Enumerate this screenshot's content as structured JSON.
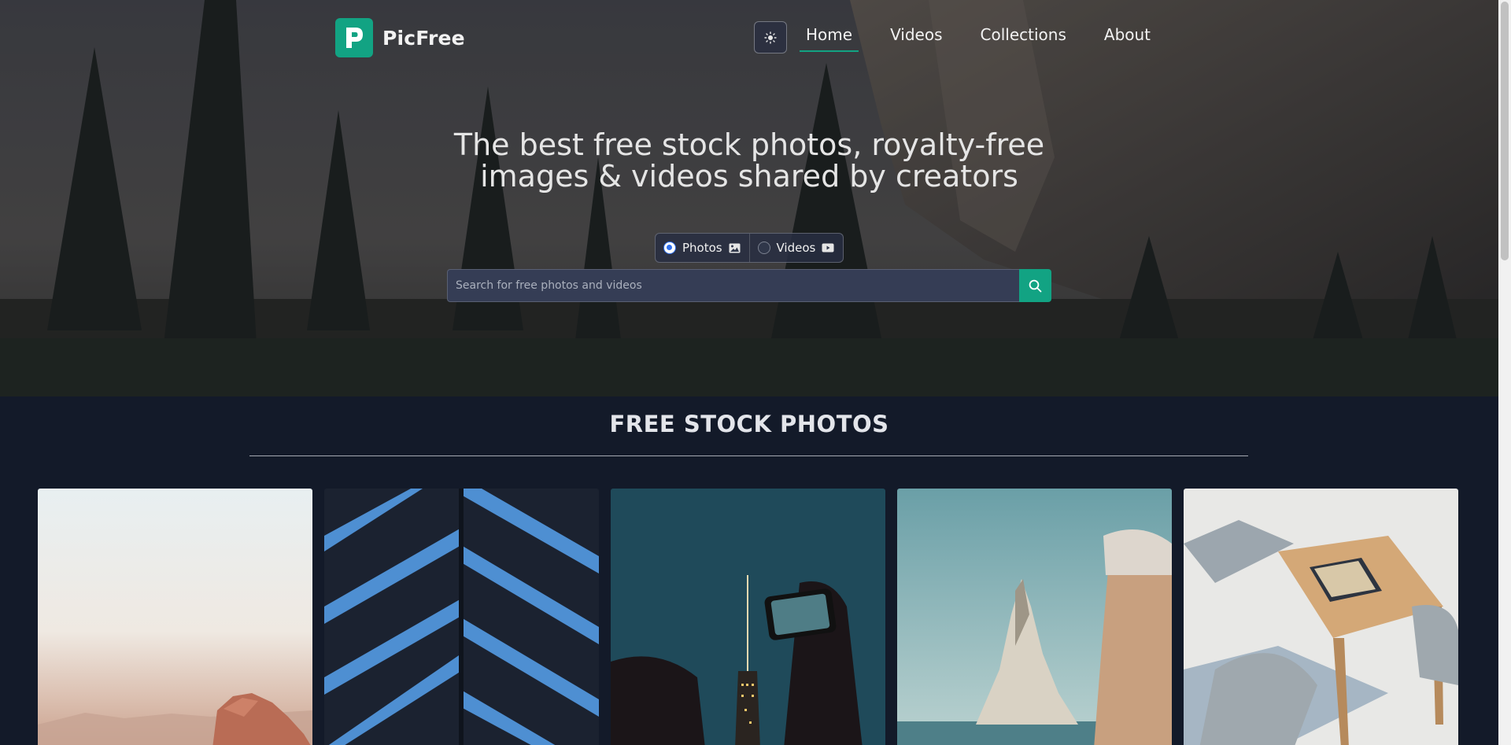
{
  "brand": {
    "name": "PicFree",
    "logo_icon": "picfree-p-logo-icon"
  },
  "theme_toggle": {
    "icon": "sun-icon"
  },
  "nav": {
    "items": [
      {
        "label": "Home",
        "active": true
      },
      {
        "label": "Videos",
        "active": false
      },
      {
        "label": "Collections",
        "active": false
      },
      {
        "label": "About",
        "active": false
      }
    ]
  },
  "hero": {
    "title_line1": "The best free stock photos, royalty-free",
    "title_line2": "images & videos shared by creators",
    "media_types": [
      {
        "label": "Photos",
        "icon": "image-icon",
        "selected": true
      },
      {
        "label": "Videos",
        "icon": "video-icon",
        "selected": false
      }
    ],
    "search": {
      "placeholder": "Search for free photos and videos",
      "value": "",
      "button_icon": "search-icon"
    }
  },
  "section": {
    "title": "FREE STOCK PHOTOS"
  },
  "photos": [
    {
      "subject": "desert-rock-photo"
    },
    {
      "subject": "building-facade-photo"
    },
    {
      "subject": "phone-skyline-photo"
    },
    {
      "subject": "sea-rock-photo"
    },
    {
      "subject": "tablet-on-table-photo"
    }
  ],
  "colors": {
    "accent": "#12a383",
    "background": "#131a29",
    "radio_selected": "#2f6fed"
  }
}
